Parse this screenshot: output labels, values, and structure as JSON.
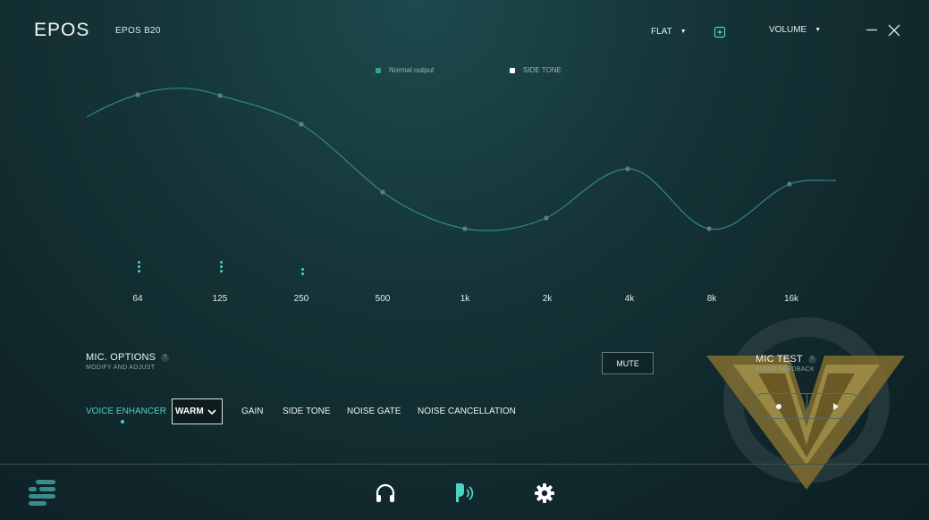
{
  "header": {
    "logo": "EPOS",
    "device_name": "EPOS B20",
    "preset": "FLAT",
    "volume_label": "VOLUME",
    "add_preset_icon": "plus-square-icon",
    "minimize_icon": "minimize-icon",
    "close_icon": "close-icon"
  },
  "legend": {
    "normal_output": "Normal output",
    "side_tone": "SIDE TONE",
    "normal_color": "#2fa394",
    "side_tone_color": "#ffffff"
  },
  "equalizer": {
    "frequencies": [
      "64",
      "125",
      "250",
      "500",
      "1k",
      "2k",
      "4k",
      "8k",
      "16k"
    ],
    "curve_color": "#2f8a86",
    "accent_color": "#4fd2c2"
  },
  "mic_options": {
    "title": "MIC. OPTIONS",
    "subtitle": "MODIFY AND ADJUST",
    "help": "?",
    "mute_label": "MUTE",
    "tabs": [
      {
        "label": "VOICE ENHANCER",
        "active": true
      },
      {
        "label": "GAIN"
      },
      {
        "label": "SIDE TONE"
      },
      {
        "label": "NOISE GATE"
      },
      {
        "label": "NOISE CANCELLATION"
      }
    ],
    "voice_enhancer_value": "WARM"
  },
  "mic_test": {
    "title": "MIC TEST",
    "subtitle": "AUDIO FEEDBACK",
    "help": "?",
    "record_icon": "record-icon",
    "play_icon": "play-icon"
  },
  "bottom_nav": {
    "items": [
      {
        "icon": "menu-icon"
      },
      {
        "icon": "headphones-icon"
      },
      {
        "icon": "microphone-icon",
        "active": true
      },
      {
        "icon": "gear-icon"
      }
    ]
  }
}
